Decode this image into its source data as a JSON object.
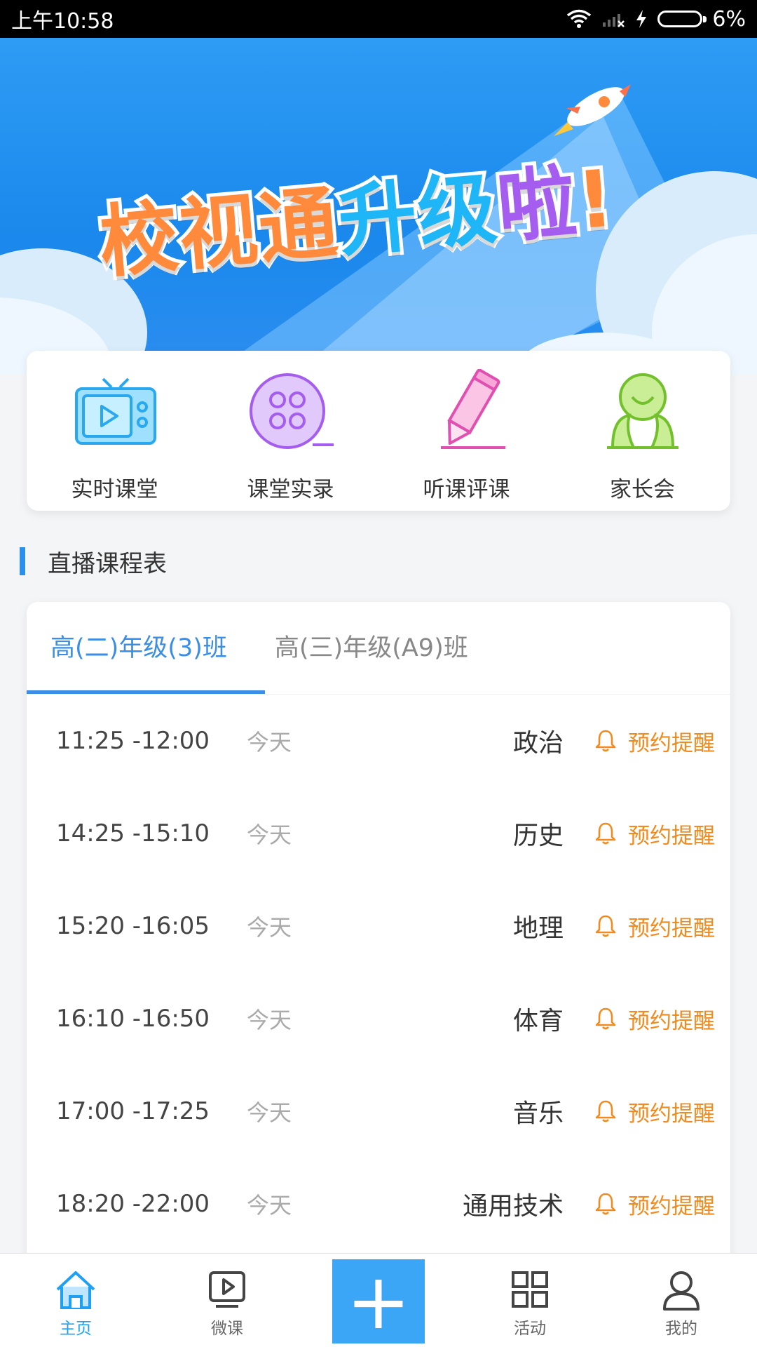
{
  "status_bar": {
    "time": "上午10:58",
    "battery": "6%"
  },
  "banner": {
    "title_parts": [
      "校视通",
      "升级",
      "啦",
      "!"
    ]
  },
  "features": [
    {
      "label": "实时课堂",
      "icon": "tv-icon"
    },
    {
      "label": "课堂实录",
      "icon": "film-reel-icon"
    },
    {
      "label": "听课评课",
      "icon": "pencil-icon"
    },
    {
      "label": "家长会",
      "icon": "parents-icon"
    }
  ],
  "section": {
    "title": "直播课程表"
  },
  "tabs": [
    {
      "label": "高(二)年级(3)班",
      "active": true
    },
    {
      "label": "高(三)年级(A9)班",
      "active": false
    }
  ],
  "schedule": [
    {
      "time": "11:25 -12:00",
      "day": "今天",
      "subject": "政治",
      "remind": "预约提醒"
    },
    {
      "time": "14:25 -15:10",
      "day": "今天",
      "subject": "历史",
      "remind": "预约提醒"
    },
    {
      "time": "15:20 -16:05",
      "day": "今天",
      "subject": "地理",
      "remind": "预约提醒"
    },
    {
      "time": "16:10 -16:50",
      "day": "今天",
      "subject": "体育",
      "remind": "预约提醒"
    },
    {
      "time": "17:00 -17:25",
      "day": "今天",
      "subject": "音乐",
      "remind": "预约提醒"
    },
    {
      "time": "18:20 -22:00",
      "day": "今天",
      "subject": "通用技术",
      "remind": "预约提醒"
    }
  ],
  "nav": {
    "home": "主页",
    "micro": "微课",
    "add": "+",
    "activity": "活动",
    "mine": "我的"
  },
  "colors": {
    "accent": "#3a8ee6",
    "remind": "#f28a1e",
    "banner_bg": "#1a88ec"
  }
}
